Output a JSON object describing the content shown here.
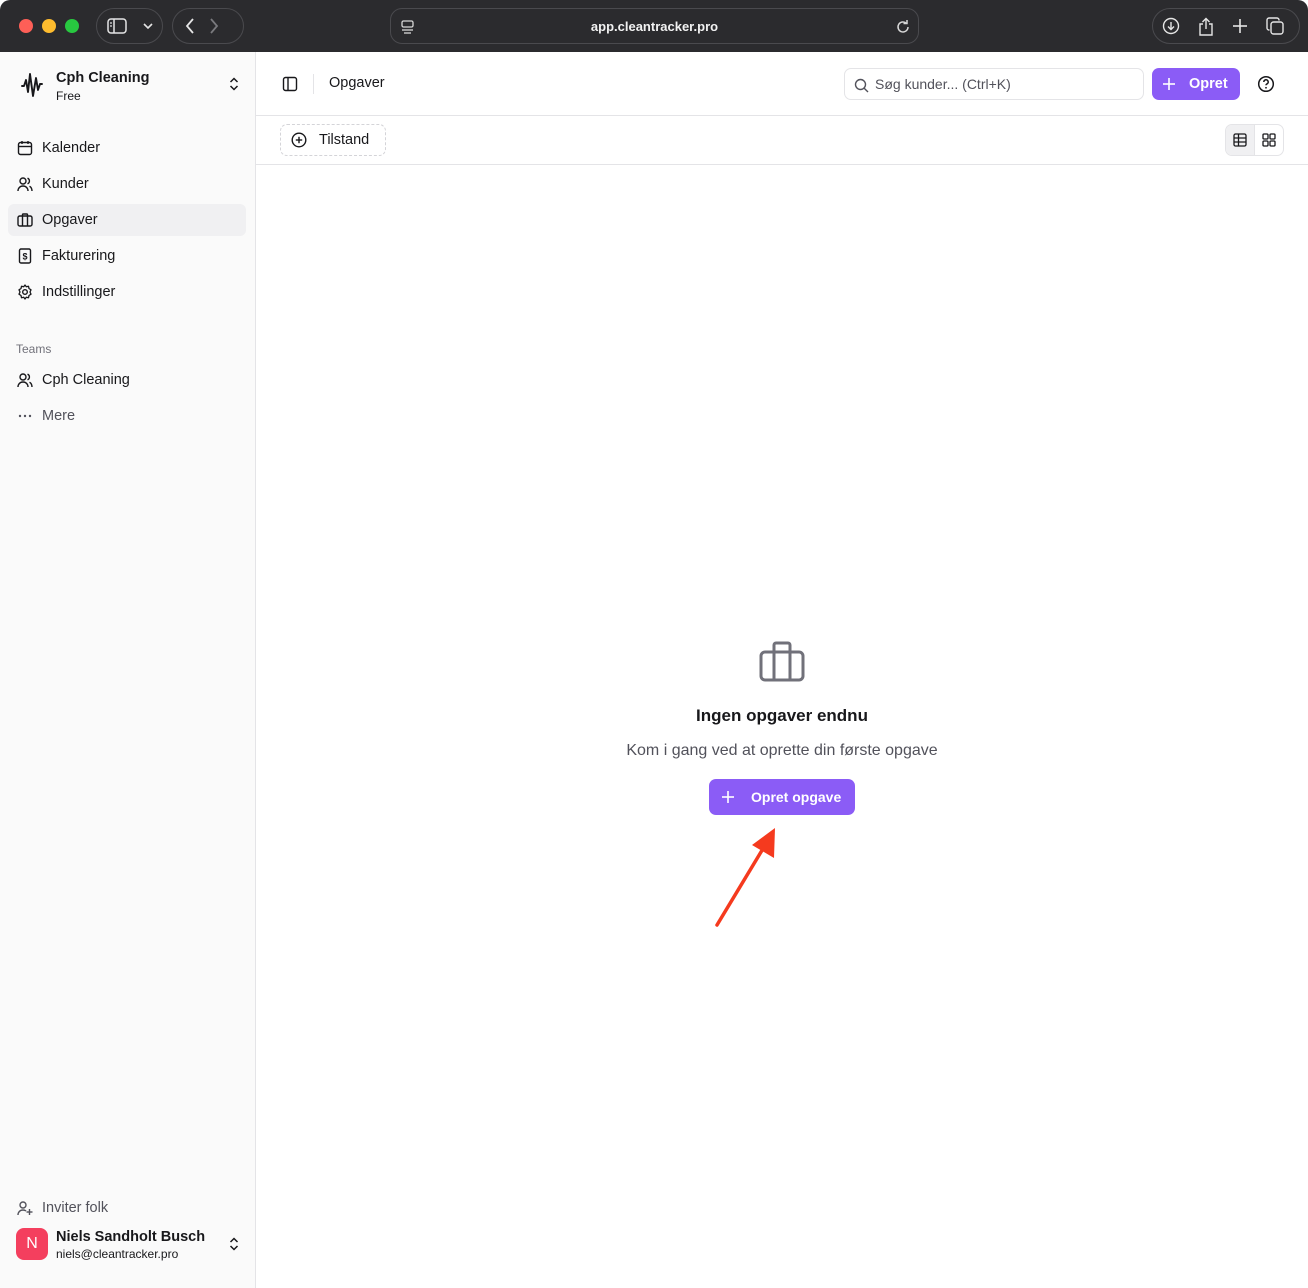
{
  "browser": {
    "url": "app.cleantracker.pro"
  },
  "sidebar": {
    "brand": {
      "name": "Cph Cleaning",
      "plan": "Free"
    },
    "items": [
      {
        "label": "Kalender",
        "icon": "calendar-icon"
      },
      {
        "label": "Kunder",
        "icon": "users-icon"
      },
      {
        "label": "Opgaver",
        "icon": "briefcase-icon",
        "active": true
      },
      {
        "label": "Fakturering",
        "icon": "invoice-icon"
      },
      {
        "label": "Indstillinger",
        "icon": "gear-icon"
      }
    ],
    "teams_label": "Teams",
    "teams": [
      {
        "label": "Cph Cleaning",
        "icon": "users-icon"
      },
      {
        "label": "Mere",
        "icon": "more-icon"
      }
    ],
    "invite_label": "Inviter folk",
    "user": {
      "initial": "N",
      "name": "Niels Sandholt Busch",
      "email": "niels@cleantracker.pro"
    }
  },
  "header": {
    "title": "Opgaver",
    "search_placeholder": "Søg kunder... (Ctrl+K)",
    "create_label": "Opret"
  },
  "filters": {
    "status_label": "Tilstand"
  },
  "empty_state": {
    "title": "Ingen opgaver endnu",
    "subtitle": "Kom i gang ved at oprette din første opgave",
    "button_label": "Opret opgave"
  },
  "colors": {
    "accent": "#8b5cf6",
    "avatar": "#f43f5e",
    "annotation_arrow": "#f53a1e"
  }
}
